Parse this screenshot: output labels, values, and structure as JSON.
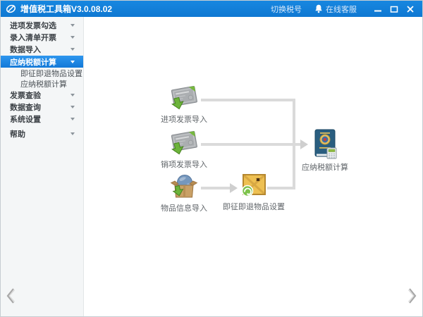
{
  "titlebar": {
    "title": "增值税工具箱V3.0.08.02",
    "switch_tax_label": "切换税号",
    "online_service_label": "在线客服"
  },
  "sidebar": {
    "items": [
      {
        "label": "进项发票勾选"
      },
      {
        "label": "录入清单开票"
      },
      {
        "label": "数据导入"
      },
      {
        "label": "应纳税额计算",
        "selected": true,
        "children": [
          {
            "label": "即征即退物品设置"
          },
          {
            "label": "应纳税额计算"
          }
        ]
      },
      {
        "label": "发票查验"
      },
      {
        "label": "数据查询"
      },
      {
        "label": "系统设置"
      },
      {
        "label": "帮助"
      }
    ]
  },
  "diagram": {
    "nodes": [
      {
        "id": "input-invoice-import",
        "label": "进项发票导入",
        "icon": "invoice-download-icon"
      },
      {
        "id": "output-invoice-import",
        "label": "销项发票导入",
        "icon": "invoice-download-icon"
      },
      {
        "id": "goods-info-import",
        "label": "物品信息导入",
        "icon": "box-globe-download-icon"
      },
      {
        "id": "refund-goods-setting",
        "label": "即征即退物品设置",
        "icon": "crate-badge-icon"
      },
      {
        "id": "tax-amount-calc",
        "label": "应纳税额计算",
        "icon": "tax-book-calculator-icon"
      }
    ],
    "flow": [
      [
        "input-invoice-import",
        "tax-amount-calc"
      ],
      [
        "output-invoice-import",
        "tax-amount-calc"
      ],
      [
        "goods-info-import",
        "refund-goods-setting"
      ],
      [
        "refund-goods-setting",
        "tax-amount-calc"
      ]
    ]
  },
  "icons": {
    "app_logo": "leaf-pen-logo",
    "online_service": "bell",
    "window_controls": [
      "minimize",
      "maximize",
      "close"
    ],
    "pagination": [
      "chevron-left",
      "chevron-right"
    ],
    "menu_caret": "chevron-down"
  },
  "colors": {
    "titlebar_blue": "#1280d8",
    "selected_item_blue": "#1e87e4",
    "sidebar_bg": "#f4f6f7",
    "connector_gray": "#dadada",
    "label_gray": "#5f6468"
  }
}
